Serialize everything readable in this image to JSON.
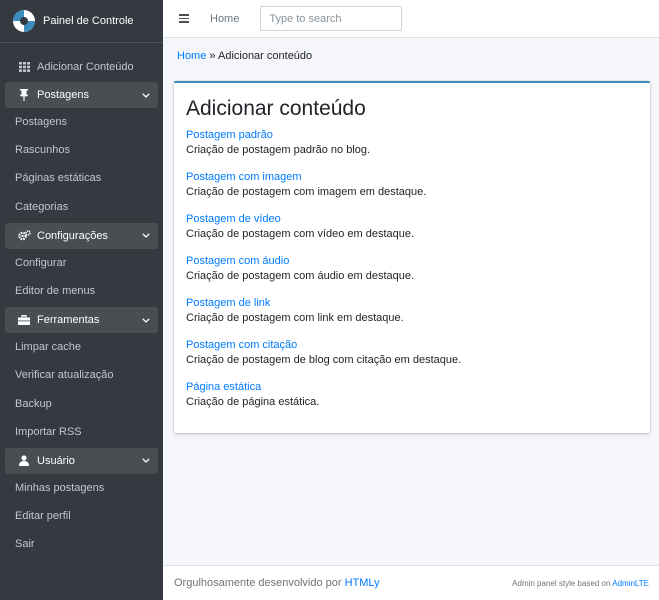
{
  "brand": {
    "title": "Painel de Controle"
  },
  "sidebar": {
    "top_item": {
      "label": "Adicionar Conteúdo",
      "icon": "grid-icon"
    },
    "sections": [
      {
        "label": "Postagens",
        "icon": "pin-icon",
        "items": [
          "Postagens",
          "Rascunhos",
          "Páginas estáticas",
          "Categorias"
        ]
      },
      {
        "label": "Configurações",
        "icon": "cogs-icon",
        "items": [
          "Configurar",
          "Editor de menus"
        ]
      },
      {
        "label": "Ferramentas",
        "icon": "toolbox-icon",
        "items": [
          "Limpar cache",
          "Verificar atualização",
          "Backup",
          "Importar RSS"
        ]
      },
      {
        "label": "Usuário",
        "icon": "user-icon",
        "items": [
          "Minhas postagens",
          "Editar perfil",
          "Sair"
        ]
      }
    ]
  },
  "topbar": {
    "home_label": "Home",
    "search_placeholder": "Type to search"
  },
  "breadcrumb": {
    "home": "Home",
    "separator": "»",
    "current": "Adicionar conteúdo"
  },
  "card": {
    "title": "Adicionar conteúdo",
    "items": [
      {
        "link": "Postagem padrão",
        "desc": "Criação de postagem padrão no blog."
      },
      {
        "link": "Postagem com imagem",
        "desc": "Criação de postagem com imagem em destaque."
      },
      {
        "link": "Postagem de vídeo",
        "desc": "Criação de postagem com vídeo em destaque."
      },
      {
        "link": "Postagem com áudio",
        "desc": "Criação de postagem com áudio em destaque."
      },
      {
        "link": "Postagem de link",
        "desc": "Criação de postagem com link em destaque."
      },
      {
        "link": "Postagem com citação",
        "desc": "Criação de postagem de blog com citação em destaque."
      },
      {
        "link": "Página estática",
        "desc": "Criação de página estática."
      }
    ]
  },
  "footer": {
    "left_text": "Orgulhosamente desenvolvido por",
    "left_link": "HTMLy",
    "right_text": "Admin panel style based on",
    "right_link": "AdminLTE"
  },
  "colors": {
    "sidebar_bg": "#343a40",
    "accent": "#3c8dbc",
    "link": "#007bff"
  }
}
